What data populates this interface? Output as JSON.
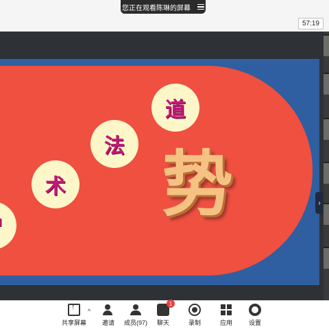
{
  "banner": {
    "text": "您正在观看陈琳的屏幕",
    "menu_icon": "menu-icon"
  },
  "timer": "57:19",
  "slide": {
    "circles": [
      "智",
      "术",
      "法",
      "道"
    ],
    "big_char": "势",
    "colors": {
      "background": "#2f5fa0",
      "shape": "#ef5040",
      "circle": "#fdf6c8",
      "circle_text": "#c2187a",
      "big_char": "#f6c283"
    }
  },
  "collapse_icon": "›",
  "toolbar": {
    "share": "共享屏幕",
    "invite": "邀请",
    "members": "成员(97)",
    "chat": "聊天",
    "chat_badge": "1",
    "record": "录制",
    "apps": "应用",
    "settings": "设置"
  }
}
